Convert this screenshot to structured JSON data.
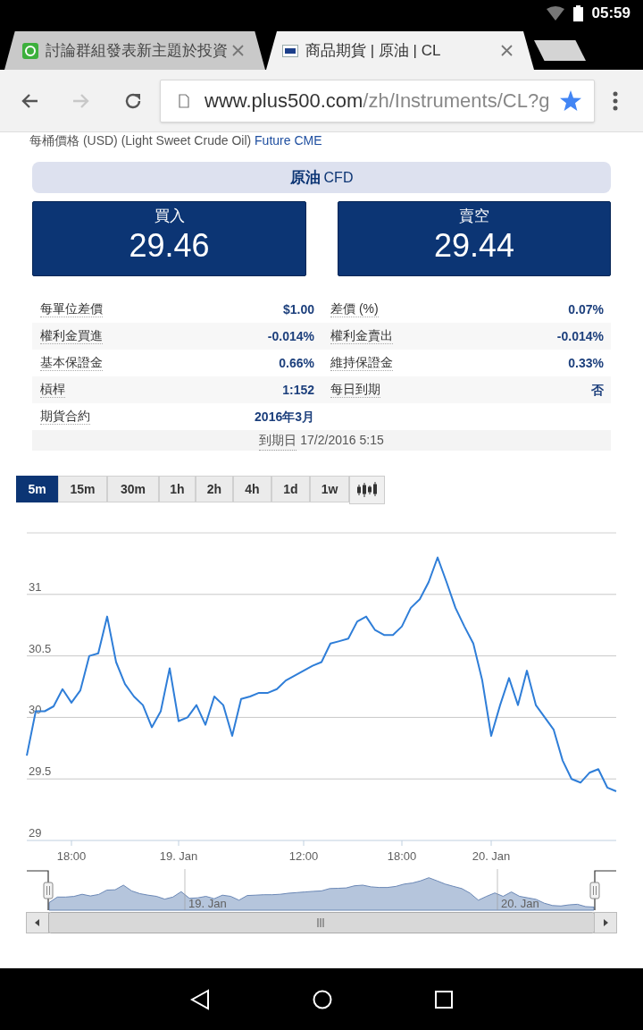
{
  "status_bar": {
    "time": "05:59"
  },
  "browser": {
    "tabs": [
      {
        "title": "討論群組發表新主題於投資",
        "selected": false
      },
      {
        "title": "商品期貨 | 原油 | CL",
        "selected": true
      }
    ],
    "url_domain": "www.plus500.com",
    "url_path": "/zh/Instruments/CL?g",
    "forward_disabled": true,
    "bookmarked": true
  },
  "page": {
    "subtitle": "每桶價格 (USD) (Light Sweet Crude Oil)",
    "subtitle_link": "Future CME",
    "instrument": {
      "name": "原油",
      "type": "CFD"
    },
    "buy": {
      "label": "買入",
      "price": "29.46"
    },
    "sell": {
      "label": "賣空",
      "price": "29.44"
    },
    "details": [
      {
        "cells": [
          {
            "label": "每單位差價",
            "value": "$1.00"
          },
          {
            "label": "差價 (%)",
            "value": "0.07%"
          }
        ]
      },
      {
        "cells": [
          {
            "label": "權利金買進",
            "value": "-0.014%"
          },
          {
            "label": "權利金賣出",
            "value": "-0.014%"
          }
        ]
      },
      {
        "cells": [
          {
            "label": "基本保證金",
            "value": "0.66%"
          },
          {
            "label": "維持保證金",
            "value": "0.33%"
          }
        ]
      },
      {
        "cells": [
          {
            "label": "槓桿",
            "value": "1:152"
          },
          {
            "label": "每日到期",
            "value": "否"
          }
        ]
      },
      {
        "cells": [
          {
            "label": "期貨合約",
            "value": "2016年3月"
          }
        ]
      }
    ],
    "expiry": {
      "label": "到期日",
      "value": "17/2/2016 5:15"
    },
    "timeframes": [
      {
        "label": "5m",
        "selected": true
      },
      {
        "label": "15m",
        "selected": false
      },
      {
        "label": "30m",
        "selected": false
      },
      {
        "label": "1h",
        "selected": false
      },
      {
        "label": "2h",
        "selected": false
      },
      {
        "label": "4h",
        "selected": false
      },
      {
        "label": "1d",
        "selected": false
      },
      {
        "label": "1w",
        "selected": false
      }
    ],
    "chart": {
      "chart_data": {
        "type": "line",
        "grid": true,
        "ylim": [
          29,
          31.5
        ],
        "yticks": [
          29,
          29.5,
          30,
          30.5,
          31
        ],
        "categories": [
          null,
          null,
          null,
          null,
          null,
          "18:00",
          null,
          null,
          null,
          null,
          null,
          null,
          null,
          null,
          null,
          null,
          null,
          "19. Jan",
          null,
          null,
          null,
          null,
          null,
          null,
          null,
          null,
          null,
          null,
          null,
          null,
          null,
          "12:00",
          null,
          null,
          null,
          null,
          null,
          null,
          null,
          null,
          null,
          null,
          "18:00",
          null,
          null,
          null,
          null,
          null,
          null,
          null,
          null,
          null,
          "20. Jan",
          null,
          null,
          null,
          null,
          null,
          null,
          null,
          null,
          null,
          null,
          null,
          null,
          null,
          null
        ],
        "series": [
          {
            "color": "#2f7ed8",
            "values": [
              29.69,
              30.05,
              30.05,
              30.09,
              30.23,
              30.12,
              30.22,
              30.5,
              30.52,
              30.82,
              30.45,
              30.27,
              30.17,
              30.1,
              29.92,
              30.05,
              30.4,
              29.97,
              30.0,
              30.1,
              29.94,
              30.17,
              30.1,
              29.85,
              30.15,
              30.17,
              30.2,
              30.2,
              30.23,
              30.3,
              30.34,
              30.38,
              30.42,
              30.45,
              30.6,
              30.62,
              30.64,
              30.78,
              30.82,
              30.71,
              30.67,
              30.67,
              30.74,
              30.89,
              30.96,
              31.1,
              31.3,
              31.1,
              30.89,
              30.74,
              30.6,
              30.3,
              29.85,
              30.1,
              30.32,
              30.1,
              30.38,
              30.1,
              30.0,
              29.9,
              29.65,
              29.5,
              29.47,
              29.55,
              29.58,
              29.43,
              29.4
            ]
          }
        ]
      }
    },
    "navigator": {
      "labels": [
        "19. Jan",
        "20. Jan"
      ]
    }
  }
}
